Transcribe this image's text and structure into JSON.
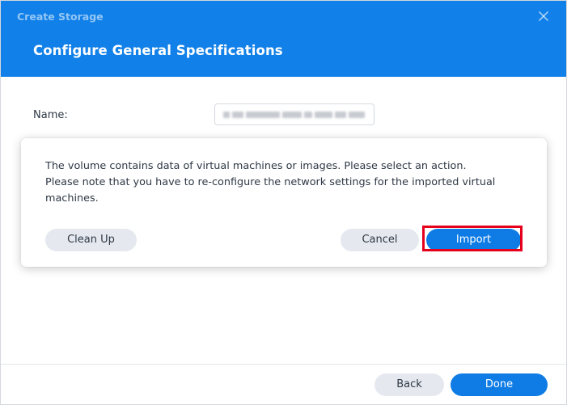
{
  "window": {
    "title": "Create Storage"
  },
  "header": {
    "page_title": "Configure General Specifications"
  },
  "form": {
    "name_label": "Name:",
    "name_value": ""
  },
  "dialog": {
    "message_lines": [
      "The volume contains data of virtual machines or images. Please select an action.",
      "Please note that you have to re-configure the network settings for the imported virtual",
      "machines."
    ],
    "cleanup_label": "Clean Up",
    "cancel_label": "Cancel",
    "import_label": "Import"
  },
  "footer": {
    "back_label": "Back",
    "done_label": "Done"
  },
  "colors": {
    "header_bg": "#1180e8",
    "primary": "#0f7ce6",
    "secondary_bg": "#e5e9ef",
    "highlight": "#e5001c"
  },
  "icons": {
    "close": "close-icon"
  }
}
